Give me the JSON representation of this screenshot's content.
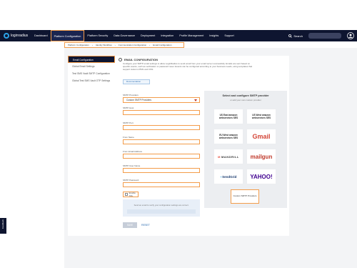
{
  "nav": {
    "logo": "loginradius",
    "items": [
      "Dashboard",
      "Platform Configuration",
      "Platform Security",
      "Data Governance",
      "Deployment",
      "Integration",
      "Profile Management",
      "Insights",
      "Support"
    ],
    "search": "Search"
  },
  "breadcrumb": [
    "Platform Configuration",
    "Identity Workflow",
    "Communication Configuration",
    "Email Configuration"
  ],
  "sidebar": [
    "Email Configuration",
    "Global Email Settings",
    "Test SMS Vault SMTP Configuration",
    "Global Test SMS Vault OTP Settings"
  ],
  "section": {
    "title": "EMAIL CONFIGURATION",
    "description": "Configure your SMTP email settings to allow LoginRadius to send email from your email server successfully. Emails are sent based on specific events, such as verification or password reset. Events can be configured according to your business needs, using templates that support custom HTML and CSS.",
    "doc_link": "Documentation"
  },
  "form": {
    "provider_label": "SMTP Providers",
    "provider_value": "Custom SMTP Providers",
    "fields": [
      "SMTP Host",
      "SMTP Port",
      "From Name",
      "From Email Address",
      "SMTP User Name",
      "SMTP Password"
    ],
    "ssl_label": "Enable SSL",
    "verify_text": "Send an email to verify your configuration settings are correct.",
    "save": "SAVE",
    "reset": "RESET"
  },
  "providers": {
    "title": "Select and configure SMTP provider",
    "subtitle": "or add your own custom provider",
    "tiles": [
      "US East amazon webservices SES",
      "US West amazon webservices SES",
      "EU West amazon webservices SES",
      "Gmail",
      "MANDRILL",
      "mailgun",
      "SendGrid",
      "YAHOO!"
    ],
    "custom": "Custom SMTP Providers"
  },
  "feedback": "Feedback",
  "colors": {
    "nav_bg": "#0e1530",
    "highlight": "#f39c4a",
    "link": "#2b6cb0"
  }
}
